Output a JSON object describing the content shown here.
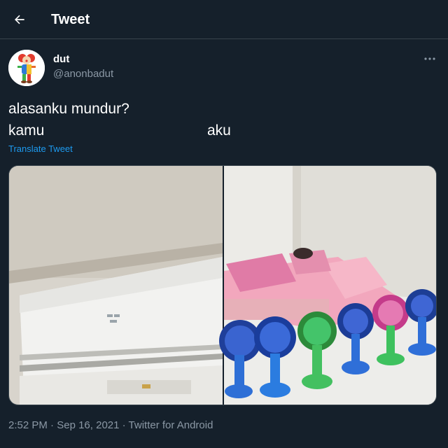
{
  "header": {
    "title": "Tweet",
    "back_icon": "arrow-left-icon"
  },
  "tweet": {
    "author": {
      "name": "dut",
      "handle": "@anonbadut",
      "avatar_icon": "clown-avatar"
    },
    "more_icon": "more-horizontal-icon",
    "text_line1": "alasanku mundur?",
    "text_line2_left": "kamu",
    "text_line2_right": "aku",
    "translate_label": "Translate Tweet",
    "media": {
      "left_image": "air-conditioner-photo",
      "right_image": "room-with-many-fans-photo"
    },
    "time": "2:52 PM",
    "date": "Sep 16, 2021",
    "source": "Twitter for Android",
    "separator": " · "
  },
  "colors": {
    "background": "#15202b",
    "secondary_text": "#8b98a5",
    "link": "#1d9bf0",
    "border": "#38444d"
  }
}
